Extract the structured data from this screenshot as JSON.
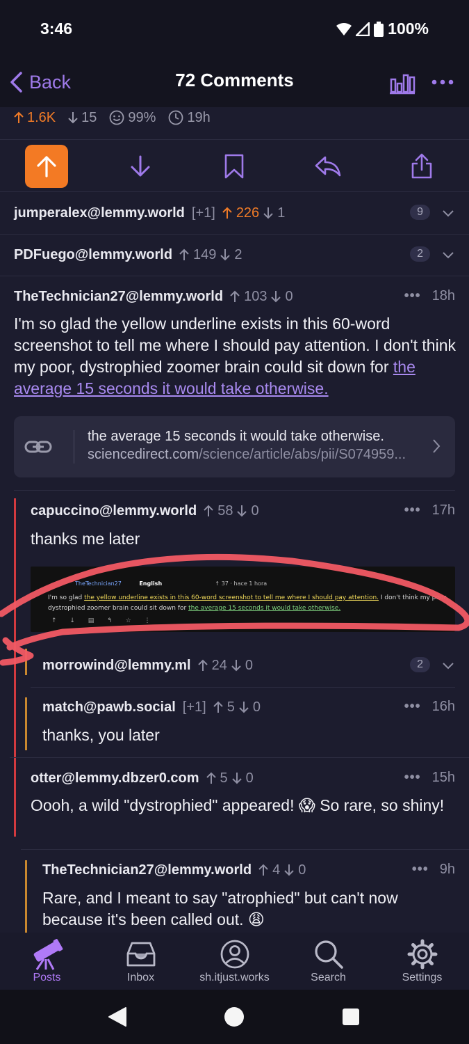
{
  "status": {
    "time": "3:46",
    "battery": "100%"
  },
  "nav": {
    "back_label": "Back",
    "title": "72 Comments"
  },
  "post_stats": {
    "upvotes": "1.6K",
    "downvotes": "15",
    "ratio": "99%",
    "age": "19h"
  },
  "comments": [
    {
      "user": "jumperalex@lemmy.world",
      "tag": "[+1]",
      "up": "226",
      "down": "1",
      "replies": "9"
    },
    {
      "user": "PDFuego@lemmy.world",
      "up": "149",
      "down": "2",
      "replies": "2"
    },
    {
      "user": "TheTechnician27@lemmy.world",
      "up": "103",
      "down": "0",
      "time": "18h",
      "text": "I'm so glad the yellow underline exists in this 60-word screenshot to tell me where I should pay attention. I don't think my poor, dystrophied zoomer brain could sit down for ",
      "link_text": "the average 15 seconds it would take otherwise.",
      "card": {
        "title": "the average 15 seconds it would take otherwise.",
        "url_domain": "sciencedirect.com",
        "url_path": "/science/article/abs/pii/S074959..."
      }
    },
    {
      "user": "capuccino@lemmy.world",
      "up": "58",
      "down": "0",
      "time": "17h",
      "text": "thanks me later",
      "screenshot": {
        "author": "TheTechnician27",
        "lang": "English",
        "score": "37",
        "age": "hace 1 hora",
        "pre": "I'm so glad ",
        "underlined": "the yellow underline exists in this 60-word screenshot to tell me where I should pay attention.",
        "mid": " I don't think my poor, dystrophied zoomer brain could sit down for ",
        "green": "the average 15 seconds it would take otherwise.",
        "icons": "↑ ↓ ▤ ↰ ☆ ⋮"
      }
    },
    {
      "user": "morrowind@lemmy.ml",
      "up": "24",
      "down": "0",
      "replies": "2"
    },
    {
      "user": "match@pawb.social",
      "tag": "[+1]",
      "up": "5",
      "down": "0",
      "time": "16h",
      "text": "thanks, you later"
    },
    {
      "user": "otter@lemmy.dbzer0.com",
      "up": "5",
      "down": "0",
      "time": "15h",
      "text": "Oooh, a wild \"dystrophied\" appeared! 😱 So rare, so shiny!"
    },
    {
      "user": "TheTechnician27@lemmy.world",
      "up": "4",
      "down": "0",
      "time": "9h",
      "text": "Rare, and I meant to say \"atrophied\" but can't now because it's been called out. 😩"
    }
  ],
  "tabs": [
    {
      "label": "Posts",
      "icon": "telescope-icon"
    },
    {
      "label": "Inbox",
      "icon": "inbox-icon"
    },
    {
      "label": "sh.itjust.works",
      "icon": "profile-icon"
    },
    {
      "label": "Search",
      "icon": "search-icon"
    },
    {
      "label": "Settings",
      "icon": "gear-icon"
    }
  ],
  "colors": {
    "accent": "#9f7aea",
    "upvote": "#f37a24",
    "background": "#1c1c2e",
    "annotation": "#f25a64"
  }
}
